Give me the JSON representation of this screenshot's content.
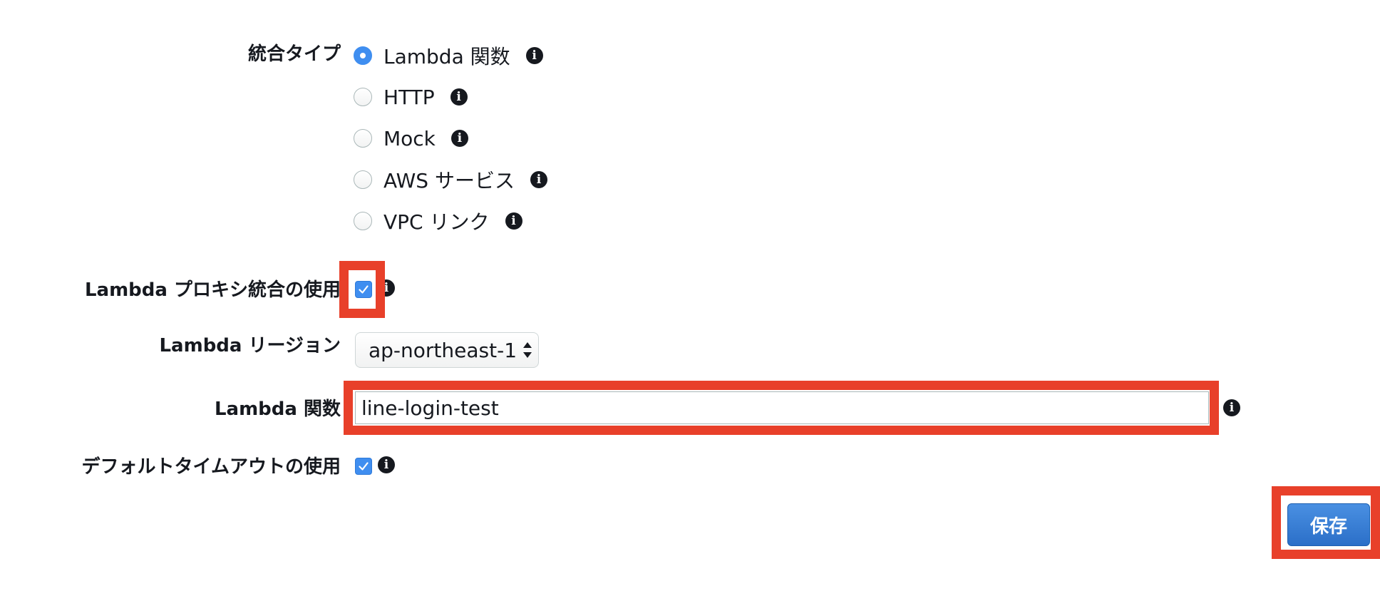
{
  "integration_type": {
    "label": "統合タイプ",
    "options": [
      {
        "label": "Lambda 関数",
        "selected": true
      },
      {
        "label": "HTTP",
        "selected": false
      },
      {
        "label": "Mock",
        "selected": false
      },
      {
        "label": "AWS サービス",
        "selected": false
      },
      {
        "label": "VPC リンク",
        "selected": false
      }
    ]
  },
  "lambda_proxy": {
    "label": "Lambda プロキシ統合の使用",
    "checked": true
  },
  "lambda_region": {
    "label": "Lambda リージョン",
    "value": "ap-northeast-1"
  },
  "lambda_function": {
    "label": "Lambda 関数",
    "value": "line-login-test"
  },
  "default_timeout": {
    "label": "デフォルトタイムアウトの使用",
    "checked": true
  },
  "save_button": {
    "label": "保存"
  },
  "info_glyph": "i",
  "colors": {
    "accent": "#3f8ef0",
    "highlight": "#e8402a",
    "button": "#2b6fc8"
  }
}
